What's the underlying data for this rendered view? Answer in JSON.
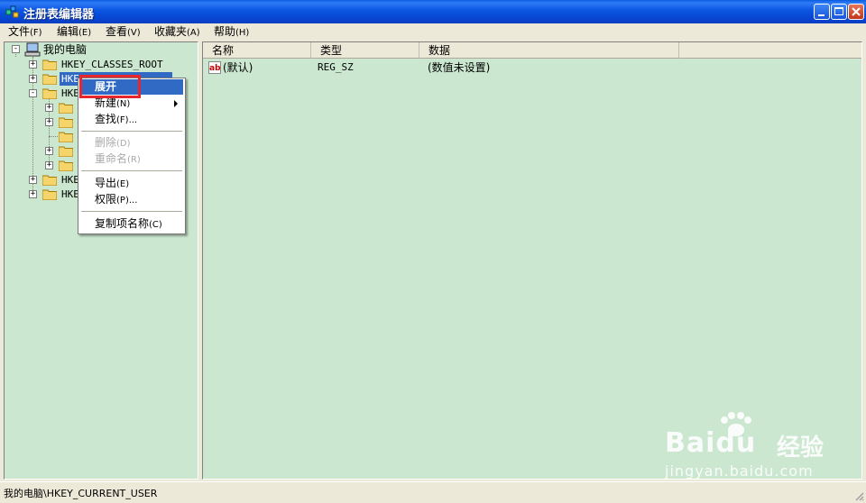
{
  "window": {
    "title": "注册表编辑器",
    "buttons": {
      "minimize": "minimize-icon",
      "maximize": "maximize-icon",
      "close": "close-icon"
    }
  },
  "menubar": [
    {
      "label": "文件",
      "accel": "(F)"
    },
    {
      "label": "编辑",
      "accel": "(E)"
    },
    {
      "label": "查看",
      "accel": "(V)"
    },
    {
      "label": "收藏夹",
      "accel": "(A)"
    },
    {
      "label": "帮助",
      "accel": "(H)"
    }
  ],
  "tree": {
    "root": "我的电脑",
    "nodes": [
      {
        "label": "HKEY_CLASSES_ROOT",
        "expander": "+"
      },
      {
        "label": "HKE",
        "expander": "+",
        "selected": true
      },
      {
        "label": "HKE",
        "expander": "-"
      },
      {
        "label": "",
        "expander": "+"
      },
      {
        "label": "",
        "expander": "+"
      },
      {
        "label": "",
        "expander": ""
      },
      {
        "label": "",
        "expander": "+"
      },
      {
        "label": "",
        "expander": "+"
      },
      {
        "label": "HKE",
        "expander": "+"
      },
      {
        "label": "HKE",
        "expander": "+"
      }
    ]
  },
  "list": {
    "columns": [
      "名称",
      "类型",
      "数据"
    ],
    "rows": [
      {
        "name": "(默认)",
        "type": "REG_SZ",
        "data": "(数值未设置)",
        "icon": "ab-string-icon"
      }
    ]
  },
  "context_menu": {
    "items": [
      {
        "label": "展开",
        "accel": "",
        "highlighted": true,
        "disabled": false
      },
      {
        "label": "新建",
        "accel": "(N)",
        "submenu": true,
        "disabled": false
      },
      {
        "label": "查找",
        "accel": "(F)...",
        "disabled": false
      },
      {
        "label": "删除",
        "accel": "(D)",
        "disabled": true
      },
      {
        "label": "重命名",
        "accel": "(R)",
        "disabled": true
      },
      {
        "label": "导出",
        "accel": "(E)",
        "disabled": false
      },
      {
        "label": "权限",
        "accel": "(P)...",
        "disabled": false
      },
      {
        "label": "复制项名称",
        "accel": "(C)",
        "disabled": false
      }
    ]
  },
  "statusbar": {
    "path": "我的电脑\\HKEY_CURRENT_USER"
  },
  "watermark": {
    "brand": "Baidu",
    "cn": "经验",
    "url": "jingyan.baidu.com"
  },
  "colors": {
    "pane_bg": "#cbe7cf",
    "highlight": "#316ac5",
    "annotation": "#e8262b",
    "titlebar": "#0a55e2"
  }
}
